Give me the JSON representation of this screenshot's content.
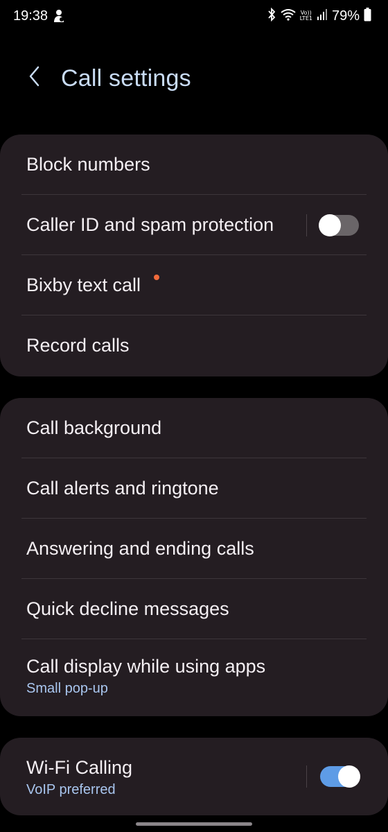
{
  "status_bar": {
    "time": "19:38",
    "volte_line1": "Vo))",
    "volte_line2": "LTE1",
    "battery": "79%",
    "icons": [
      "notification-icon",
      "bluetooth-icon",
      "wifi-icon",
      "signal-icon",
      "battery-icon"
    ]
  },
  "header": {
    "title": "Call settings",
    "back_icon": "chevron-left-icon"
  },
  "group1": {
    "items": [
      {
        "label": "Block numbers"
      },
      {
        "label": "Caller ID and spam protection",
        "toggle": "off"
      },
      {
        "label": "Bixby text call",
        "new_badge": true
      },
      {
        "label": "Record calls"
      }
    ]
  },
  "group2": {
    "items": [
      {
        "label": "Call background"
      },
      {
        "label": "Call alerts and ringtone"
      },
      {
        "label": "Answering and ending calls"
      },
      {
        "label": "Quick decline messages"
      },
      {
        "label": "Call display while using apps",
        "sub": "Small pop-up"
      }
    ]
  },
  "group3": {
    "items": [
      {
        "label": "Wi-Fi Calling",
        "sub": "VoIP preferred",
        "toggle": "on"
      }
    ]
  },
  "colors": {
    "background": "#000000",
    "card": "#241d22",
    "title": "#c9dcf5",
    "accent": "#5e9ce6",
    "subtext": "#a9c6ef",
    "badge": "#f06a3b"
  }
}
